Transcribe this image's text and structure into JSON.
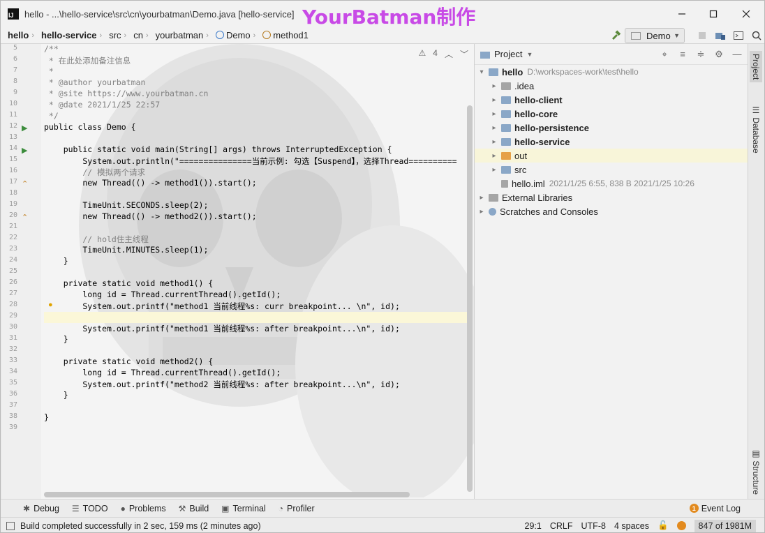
{
  "window": {
    "title": "hello - ...\\hello-service\\src\\cn\\yourbatman\\Demo.java [hello-service]",
    "watermark": "YourBatman制作",
    "logo_text": "IJ"
  },
  "breadcrumbs": [
    "hello",
    "hello-service",
    "src",
    "cn",
    "yourbatman",
    "Demo",
    "method1"
  ],
  "toolbar": {
    "run_config": "Demo"
  },
  "editor": {
    "inspection_count": "4",
    "first_line": 5,
    "lines": [
      {
        "t": "/**",
        "c": "cm"
      },
      {
        "t": " * 在此处添加备注信息",
        "c": "cm"
      },
      {
        "t": " *",
        "c": "cm"
      },
      {
        "t": " * @author yourbatman",
        "c": "cm"
      },
      {
        "t": " * @site https://www.yourbatman.cn",
        "c": "cm"
      },
      {
        "t": " * @date 2021/1/25 22:57",
        "c": "cm"
      },
      {
        "t": " */",
        "c": "cm"
      },
      {
        "t": "public class Demo {",
        "c": ""
      },
      {
        "t": "",
        "c": ""
      },
      {
        "t": "    public static void main(String[] args) throws InterruptedException {",
        "c": ""
      },
      {
        "t": "        System.out.println(\"===============当前示例: 勾选【Suspend】，选择Thread==========",
        "c": ""
      },
      {
        "t": "        // 模拟两个请求",
        "c": "cm"
      },
      {
        "t": "        new Thread(() -> method1()).start();",
        "c": ""
      },
      {
        "t": "",
        "c": ""
      },
      {
        "t": "        TimeUnit.SECONDS.sleep(2);",
        "c": ""
      },
      {
        "t": "        new Thread(() -> method2()).start();",
        "c": ""
      },
      {
        "t": "",
        "c": ""
      },
      {
        "t": "        // hold住主线程",
        "c": "cm"
      },
      {
        "t": "        TimeUnit.MINUTES.sleep(1);",
        "c": ""
      },
      {
        "t": "    }",
        "c": ""
      },
      {
        "t": "",
        "c": ""
      },
      {
        "t": "    private static void method1() {",
        "c": ""
      },
      {
        "t": "        long id = Thread.currentThread().getId();",
        "c": ""
      },
      {
        "t": "        System.out.printf(\"method1 当前线程%s: curr breakpoint... \\n\", id);",
        "c": ""
      },
      {
        "t": "",
        "c": ""
      },
      {
        "t": "        System.out.printf(\"method1 当前线程%s: after breakpoint...\\n\", id);",
        "c": ""
      },
      {
        "t": "    }",
        "c": ""
      },
      {
        "t": "",
        "c": ""
      },
      {
        "t": "    private static void method2() {",
        "c": ""
      },
      {
        "t": "        long id = Thread.currentThread().getId();",
        "c": ""
      },
      {
        "t": "        System.out.printf(\"method2 当前线程%s: after breakpoint...\\n\", id);",
        "c": ""
      },
      {
        "t": "    }",
        "c": ""
      },
      {
        "t": "",
        "c": ""
      },
      {
        "t": "}",
        "c": ""
      },
      {
        "t": "",
        "c": ""
      }
    ]
  },
  "project": {
    "title": "Project",
    "tree": [
      {
        "name": "hello",
        "path": "D:\\workspaces-work\\test\\hello",
        "bold": true,
        "indent": 0,
        "arrow": "▾",
        "icon": "folder"
      },
      {
        "name": ".idea",
        "indent": 1,
        "arrow": "▸",
        "icon": "gray"
      },
      {
        "name": "hello-client",
        "bold": true,
        "indent": 1,
        "arrow": "▸",
        "icon": "folder"
      },
      {
        "name": "hello-core",
        "bold": true,
        "indent": 1,
        "arrow": "▸",
        "icon": "folder"
      },
      {
        "name": "hello-persistence",
        "bold": true,
        "indent": 1,
        "arrow": "▸",
        "icon": "folder"
      },
      {
        "name": "hello-service",
        "bold": true,
        "indent": 1,
        "arrow": "▸",
        "icon": "folder"
      },
      {
        "name": "out",
        "indent": 1,
        "arrow": "▸",
        "icon": "orange",
        "selected": true
      },
      {
        "name": "src",
        "indent": 1,
        "arrow": "▸",
        "icon": "folder"
      },
      {
        "name": "hello.iml",
        "meta": "2021/1/25 6:55, 838 B 2021/1/25 10:26",
        "indent": 1,
        "arrow": "",
        "icon": "file"
      },
      {
        "name": "External Libraries",
        "indent": 0,
        "arrow": "▸",
        "icon": "lib"
      },
      {
        "name": "Scratches and Consoles",
        "indent": 0,
        "arrow": "▸",
        "icon": "scratch"
      }
    ]
  },
  "side_tabs": {
    "project": "Project",
    "database": "Database",
    "structure": "Structure"
  },
  "tool_windows": [
    "Debug",
    "TODO",
    "Problems",
    "Build",
    "Terminal",
    "Profiler"
  ],
  "event_log": {
    "label": "Event Log",
    "count": "1"
  },
  "status": {
    "message": "Build completed successfully in 2 sec, 159 ms (2 minutes ago)",
    "position": "29:1",
    "line_sep": "CRLF",
    "encoding": "UTF-8",
    "indent": "4 spaces",
    "memory": "847 of 1981M"
  }
}
